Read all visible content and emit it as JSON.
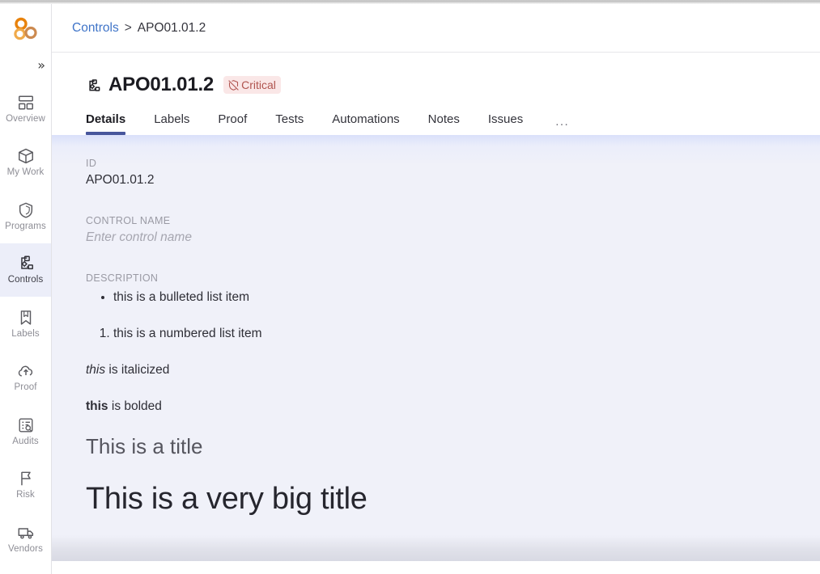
{
  "app": {
    "logo_name": "three-circles-logo",
    "accent_blue": "#47569c",
    "link_blue": "#3f74c8",
    "critical_bg": "#fae7e7",
    "critical_fg": "#b0544f",
    "content_bg": "#f0f1f9"
  },
  "sidebar": {
    "collapse_label": "»",
    "items": [
      {
        "label": "Overview",
        "icon": "dashboard-icon",
        "active": false
      },
      {
        "label": "My Work",
        "icon": "box-icon",
        "active": false
      },
      {
        "label": "Programs",
        "icon": "shield-icon",
        "active": false
      },
      {
        "label": "Controls",
        "icon": "sitemap-icon",
        "active": true
      },
      {
        "label": "Labels",
        "icon": "bookmark-icon",
        "active": false
      },
      {
        "label": "Proof",
        "icon": "cloud-upload-icon",
        "active": false
      },
      {
        "label": "Audits",
        "icon": "audit-search-icon",
        "active": false
      },
      {
        "label": "Risk",
        "icon": "flag-icon",
        "active": false
      },
      {
        "label": "Vendors",
        "icon": "truck-icon",
        "active": false
      }
    ]
  },
  "breadcrumb": {
    "root": "Controls",
    "separator": ">",
    "current": "APO01.01.2"
  },
  "header": {
    "icon": "sitemap-icon",
    "title": "APO01.01.2",
    "badge": {
      "label": "Critical",
      "icon": "shield-off-icon"
    }
  },
  "tabs": {
    "items": [
      {
        "label": "Details",
        "active": true
      },
      {
        "label": "Labels",
        "active": false
      },
      {
        "label": "Proof",
        "active": false
      },
      {
        "label": "Tests",
        "active": false
      },
      {
        "label": "Automations",
        "active": false
      },
      {
        "label": "Notes",
        "active": false
      },
      {
        "label": "Issues",
        "active": false
      }
    ],
    "overflow_label": "..."
  },
  "details": {
    "id": {
      "label": "ID",
      "value": "APO01.01.2"
    },
    "control_name": {
      "label": "CONTROL NAME",
      "placeholder": "Enter control name",
      "value": ""
    },
    "description": {
      "label": "DESCRIPTION",
      "bullet_item": "this is a bulleted list item",
      "numbered_item": "this is a numbered list item",
      "italic_word": "this",
      "italic_rest": " is italicized",
      "bold_word": "this",
      "bold_rest": " is bolded",
      "title": "This is a title",
      "big_title": "This is a very big title"
    }
  }
}
